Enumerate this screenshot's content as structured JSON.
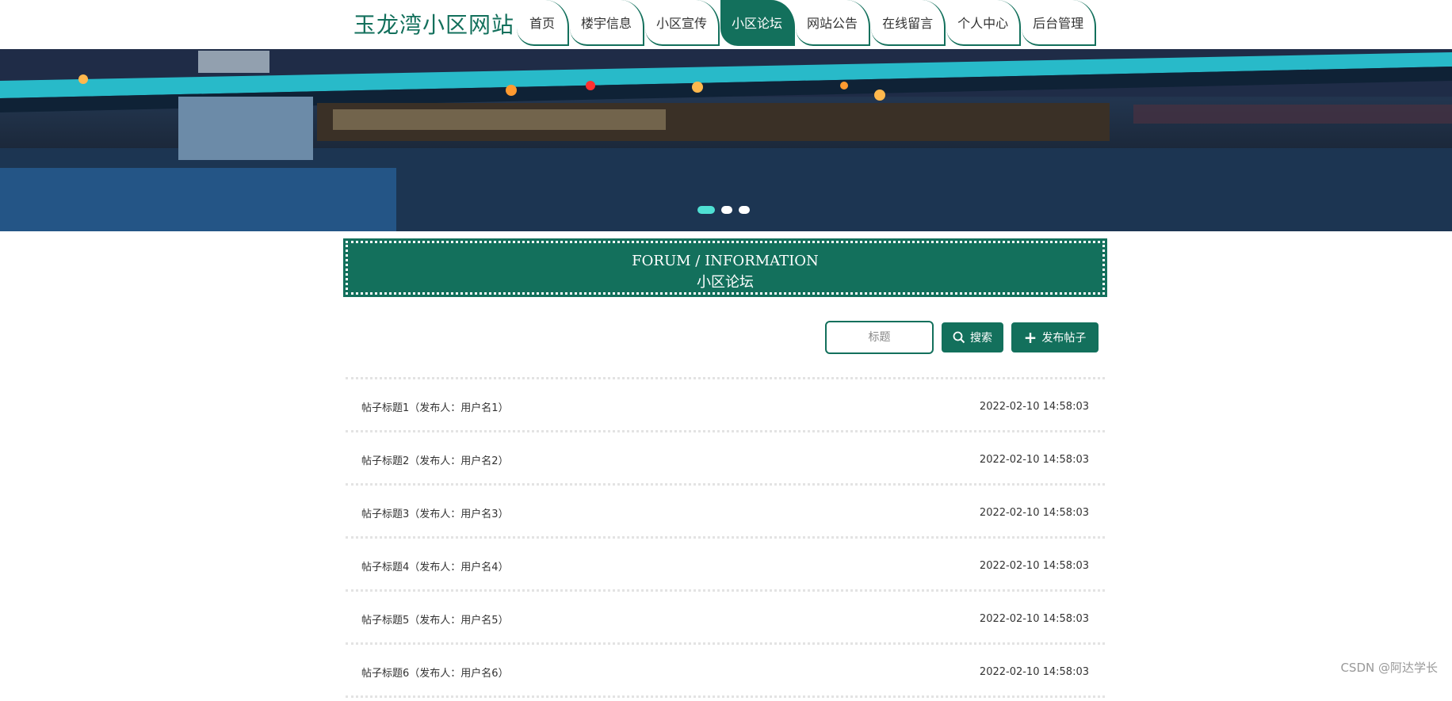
{
  "header": {
    "site_title": "玉龙湾小区网站",
    "nav": [
      {
        "label": "首页",
        "active": false
      },
      {
        "label": "楼宇信息",
        "active": false
      },
      {
        "label": "小区宣传",
        "active": false
      },
      {
        "label": "小区论坛",
        "active": true
      },
      {
        "label": "网站公告",
        "active": false
      },
      {
        "label": "在线留言",
        "active": false
      },
      {
        "label": "个人中心",
        "active": false
      },
      {
        "label": "后台管理",
        "active": false
      }
    ]
  },
  "banner": {
    "slides": 3,
    "active_slide": 1
  },
  "section": {
    "title_en": "FORUM / INFORMATION",
    "title_cn": "小区论坛"
  },
  "toolbar": {
    "search_placeholder": "标题",
    "search_label": "搜索",
    "post_label": "发布帖子"
  },
  "posts": [
    {
      "title": "帖子标题1",
      "author_prefix": "（发布人：",
      "author": "用户名1",
      "author_suffix": "）",
      "time": "2022-02-10 14:58:03"
    },
    {
      "title": "帖子标题2",
      "author_prefix": "（发布人：",
      "author": "用户名2",
      "author_suffix": "）",
      "time": "2022-02-10 14:58:03"
    },
    {
      "title": "帖子标题3",
      "author_prefix": "（发布人：",
      "author": "用户名3",
      "author_suffix": "）",
      "time": "2022-02-10 14:58:03"
    },
    {
      "title": "帖子标题4",
      "author_prefix": "（发布人：",
      "author": "用户名4",
      "author_suffix": "）",
      "time": "2022-02-10 14:58:03"
    },
    {
      "title": "帖子标题5",
      "author_prefix": "（发布人：",
      "author": "用户名5",
      "author_suffix": "）",
      "time": "2022-02-10 14:58:03"
    },
    {
      "title": "帖子标题6",
      "author_prefix": "（发布人：",
      "author": "用户名6",
      "author_suffix": "）",
      "time": "2022-02-10 14:58:03"
    }
  ],
  "watermark": "CSDN @阿达学长",
  "colors": {
    "accent": "#13705c",
    "dot_active": "#4fe0d3"
  },
  "icons": {
    "search": "search-icon",
    "post": "plus-icon"
  }
}
